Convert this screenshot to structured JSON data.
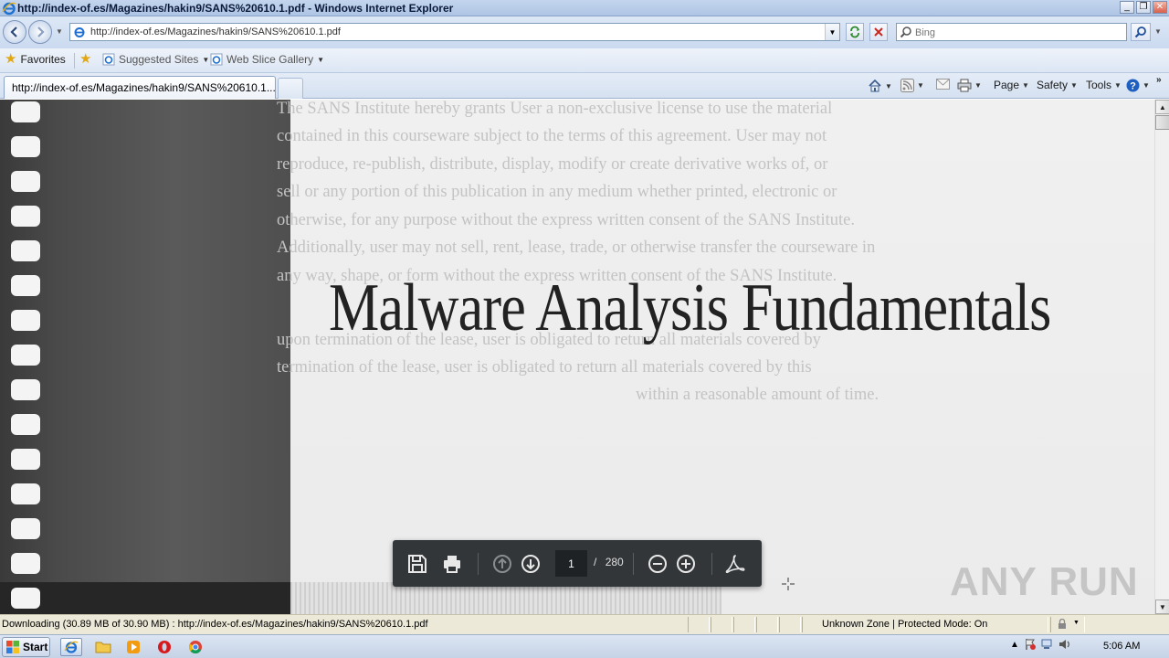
{
  "window": {
    "title": "http://index-of.es/Magazines/hakin9/SANS%20610.1.pdf - Windows Internet Explorer",
    "controls": [
      "_",
      "❐",
      "✕"
    ]
  },
  "address_bar": {
    "url": "http://index-of.es/Magazines/hakin9/SANS%20610.1.pdf"
  },
  "search": {
    "placeholder": "Bing"
  },
  "favorites_bar": {
    "favorites_label": "Favorites",
    "suggested_sites": "Suggested Sites",
    "web_slice_gallery": "Web Slice Gallery"
  },
  "tab": {
    "title": "http://index-of.es/Magazines/hakin9/SANS%20610.1..."
  },
  "command_bar": {
    "page": "Page",
    "safety": "Safety",
    "tools": "Tools"
  },
  "document": {
    "title": "Malware Analysis Fundamentals",
    "bleed_lines": [
      "The SANS Institute hereby grants User a non-exclusive license to use the material",
      "contained in this courseware subject to the terms of this agreement. User may not",
      "reproduce, re-publish, distribute, display, modify or create derivative works of, or",
      "sell or any portion of this publication in any medium whether printed, electronic or",
      "otherwise, for any purpose without the express written consent of the SANS Institute.",
      "Additionally, user may not sell, rent, lease, trade, or otherwise transfer the courseware in",
      "any way, shape, or form without the express written consent of the SANS Institute.",
      "",
      "",
      "upon termination of the lease, user is obligated to return all materials covered by",
      "termination of the lease, user is obligated to return all materials covered by this",
      "within a reasonable amount of time."
    ]
  },
  "pdf_toolbar": {
    "current_page": "1",
    "separator": "/",
    "total_pages": "280"
  },
  "watermark": "ANY RUN",
  "status_bar": {
    "message": "Downloading (30.89 MB of 30.90 MB) : http://index-of.es/Magazines/hakin9/SANS%20610.1.pdf",
    "zone": "Unknown Zone | Protected Mode: On"
  },
  "taskbar": {
    "start_label": "Start",
    "clock": "5:06 AM"
  }
}
